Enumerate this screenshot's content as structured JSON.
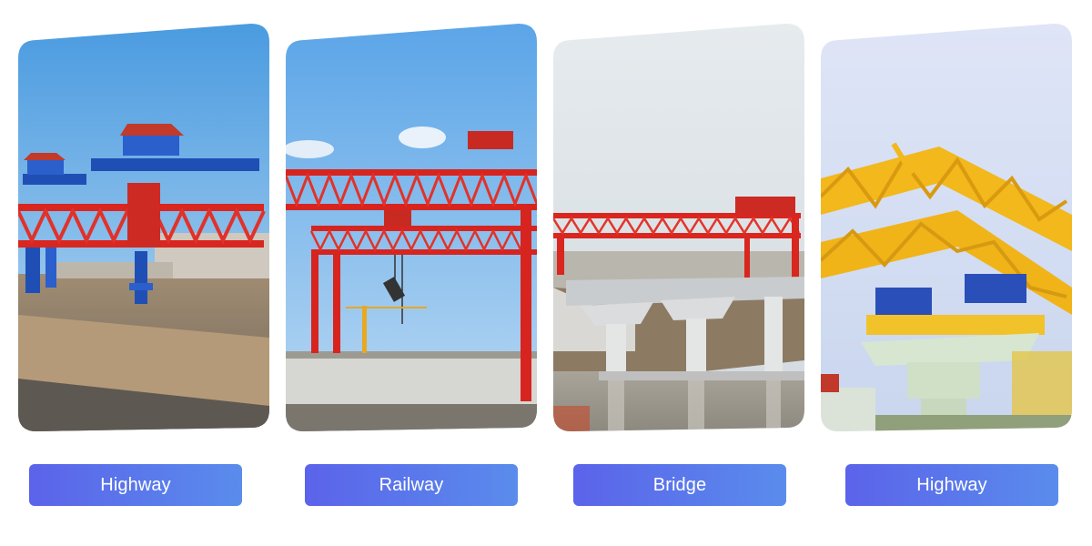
{
  "cards": [
    {
      "label": "Highway",
      "image": "highway-bridge-girder-launcher-photo"
    },
    {
      "label": "Railway",
      "image": "railway-gantry-crane-photo"
    },
    {
      "label": "Bridge",
      "image": "bridge-girder-erection-crane-photo"
    },
    {
      "label": "Highway",
      "image": "yellow-highway-bridge-launcher-photo"
    }
  ],
  "colors": {
    "button_gradient_start": "#5b63ea",
    "button_gradient_end": "#5a8cec",
    "button_text": "#ffffff"
  }
}
